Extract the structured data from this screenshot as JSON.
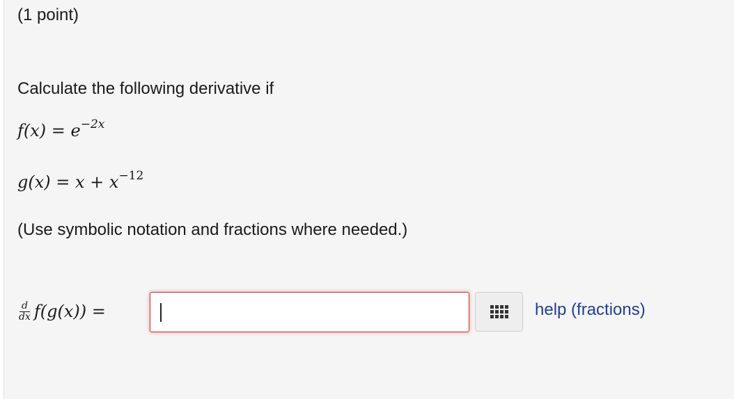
{
  "problem": {
    "points_label": "(1 point)",
    "prompt": "Calculate the following derivative if",
    "f_def": {
      "lhs": "f(x) = e",
      "exponent": "−2x"
    },
    "g_def": {
      "lhs": "g(x) = x + x",
      "exponent": "−12"
    },
    "note": "(Use symbolic notation and fractions where needed.)"
  },
  "answer": {
    "derivative": {
      "numerator": "d",
      "denominator": "dx",
      "expression": "f(g(x)) ="
    },
    "input_value": "",
    "keyboard_icon": "keypad-grid-icon",
    "help_link": "help (fractions)"
  },
  "colors": {
    "background": "#f5f5f5",
    "input_error_border": "#c9302c",
    "link": "#1f3f96"
  }
}
